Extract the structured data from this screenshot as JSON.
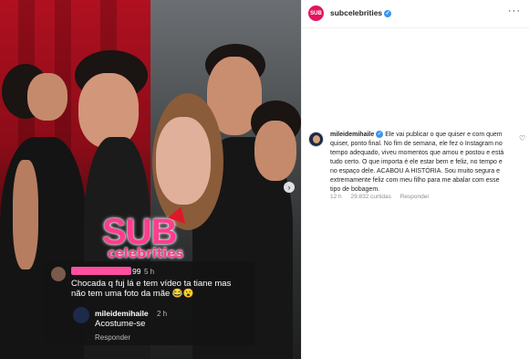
{
  "account": {
    "username": "subcelebrities",
    "avatar_text": "SUB",
    "verified_icon": "verified-badge-icon",
    "more_icon": "more-options-icon"
  },
  "caption": {
    "username": "mileidemihaile",
    "text": "Ele vai publicar o que quiser e com quem quiser, ponto final. No fim de semana, ele fez o Instagram no tempo adequado, viveu momentos que amou e postou e está tudo certo. O que importa é ele estar bem e feliz, no tempo e no espaço dele. ACABOU A HISTÓRIA. Sou muito segura e extremamente feliz com meu filho para me abalar com esse tipo de bobagem.",
    "time": "12 h",
    "likes": "29.832 curtidas",
    "reply_label": "Responder"
  },
  "media": {
    "watermark_main": "SUB",
    "watermark_sub": "celebrities",
    "embedded_comment": {
      "user_suffix": "99",
      "time": "5 h",
      "text_line1": "Chocada q fuj lá e tem vídeo ta tiane mas",
      "text_line2": "não tem uma foto da mãe 😂😮"
    },
    "embedded_reply": {
      "username": "mileidemihaile",
      "time": "2 h",
      "text": "Acostume-se",
      "reply_label": "Responder"
    }
  },
  "colors": {
    "brand": "#ff3c8e",
    "verified": "#3897f0",
    "accent_red": "#e4145f"
  }
}
